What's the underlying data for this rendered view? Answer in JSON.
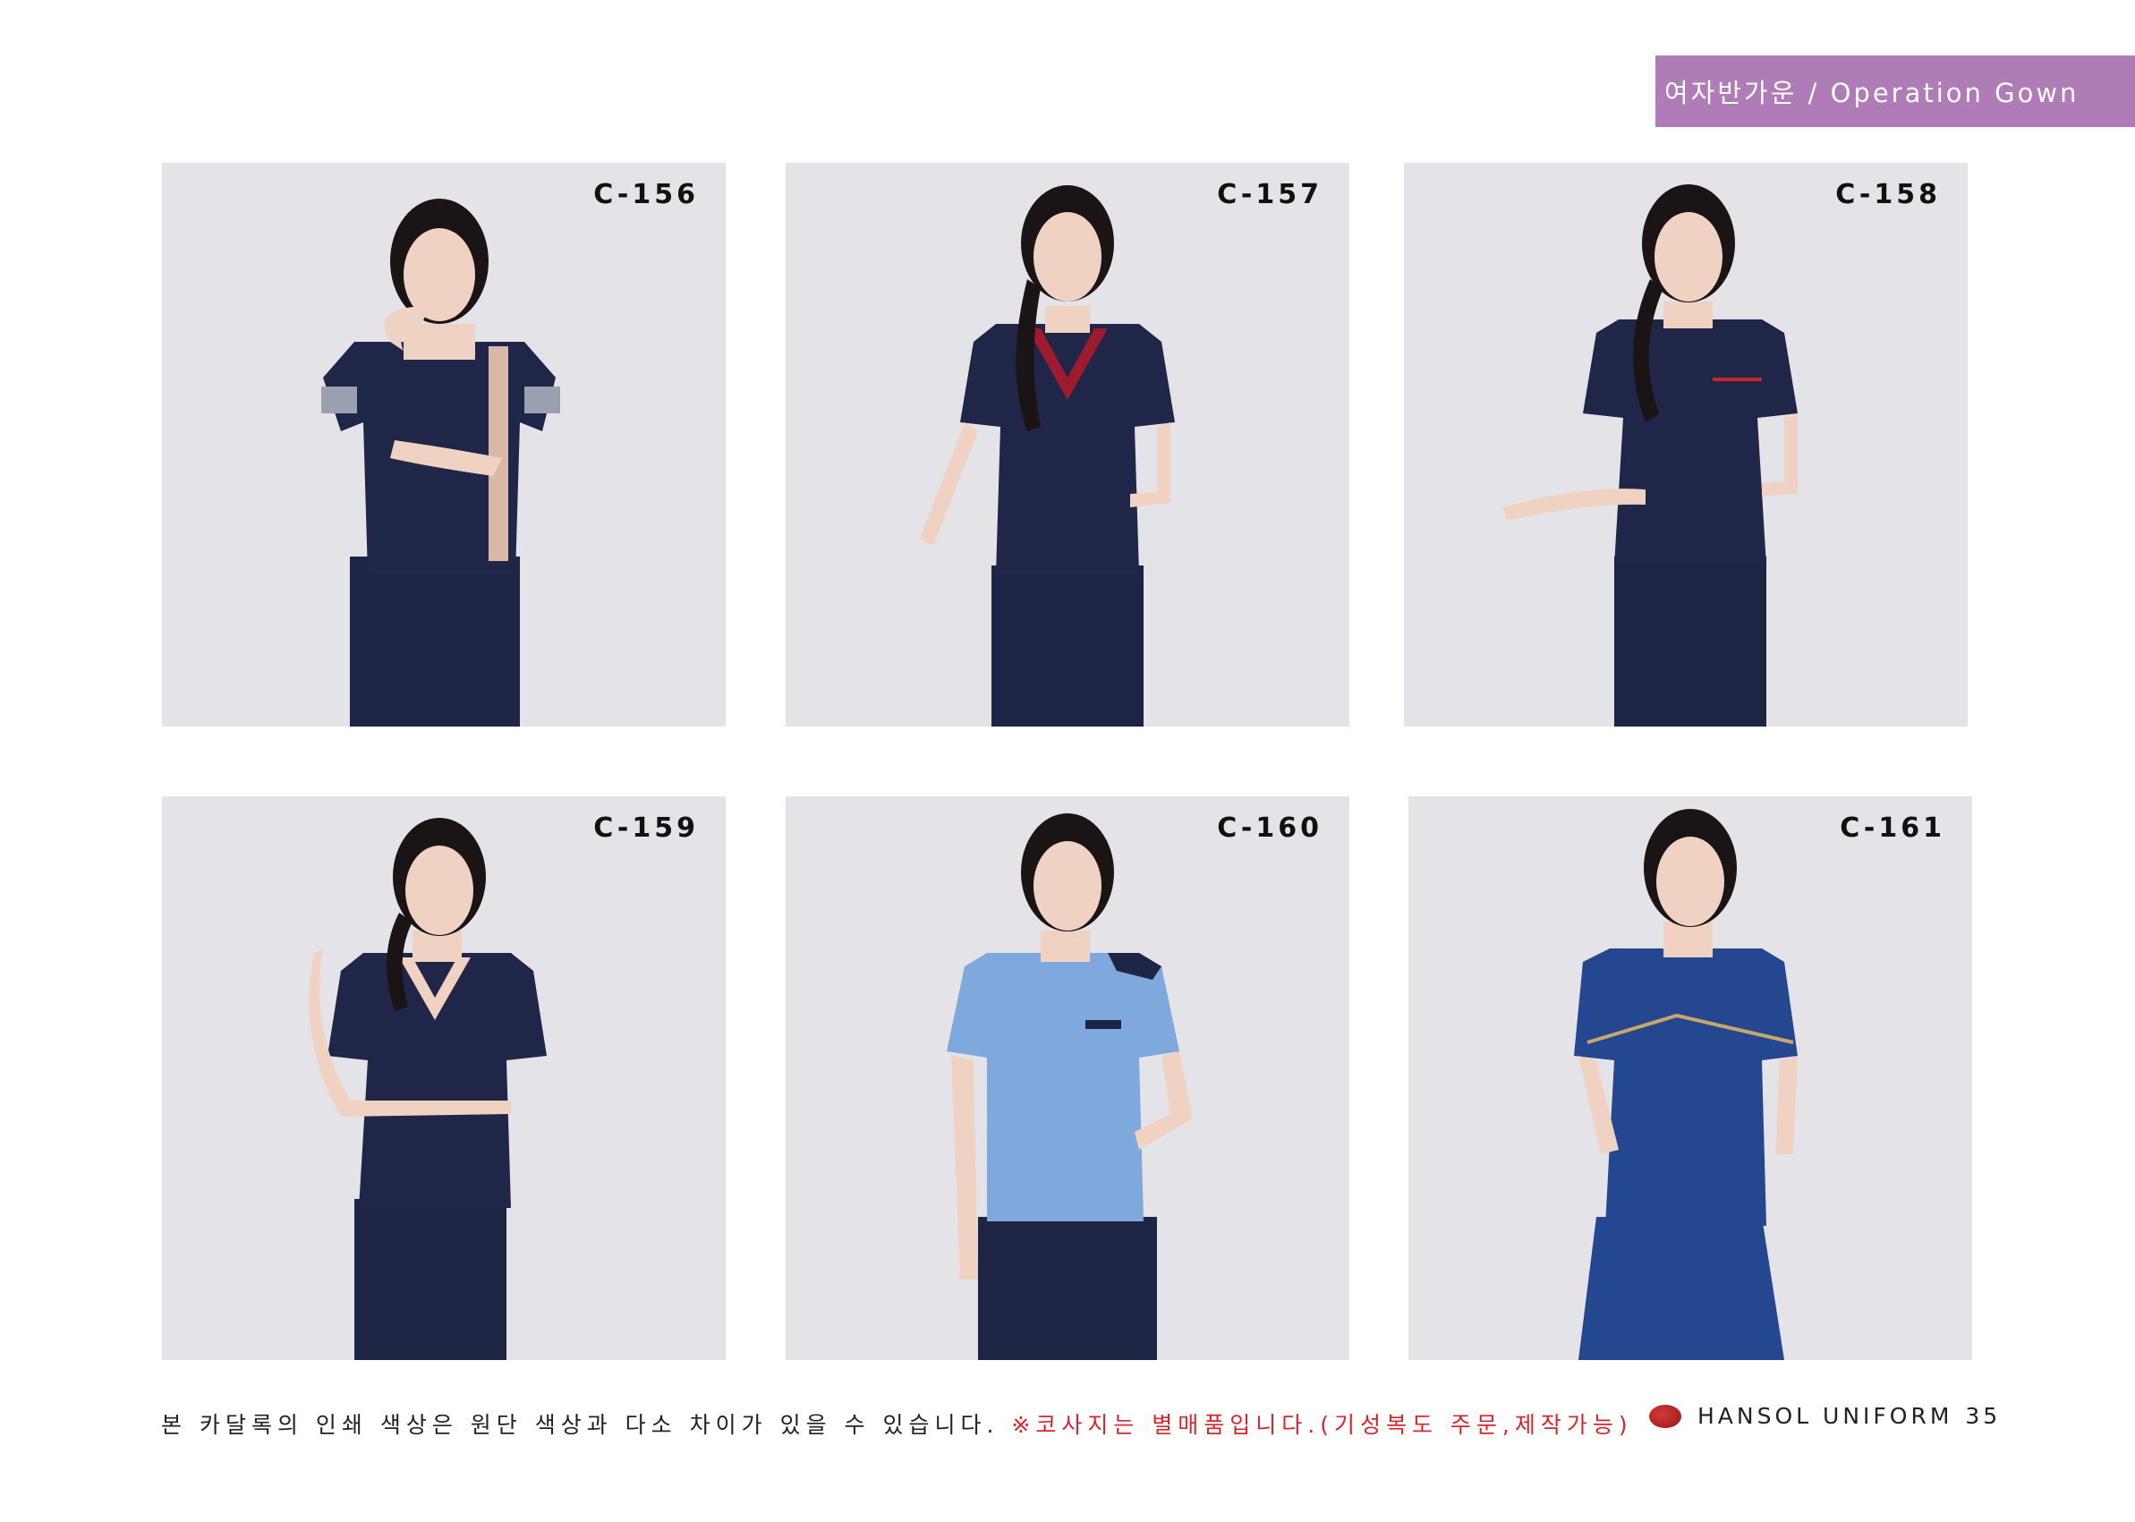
{
  "header": {
    "category_label": "여자반가운 / Operation Gown"
  },
  "products": [
    {
      "code": "C-156",
      "top_color": "#1f2647",
      "trim": "pink-grey strap"
    },
    {
      "code": "C-157",
      "top_color": "#1f2647",
      "trim": "red V-neck"
    },
    {
      "code": "C-158",
      "top_color": "#1f2647",
      "trim": "red pocket line"
    },
    {
      "code": "C-159",
      "top_color": "#1f2647",
      "trim": "plain V-neck"
    },
    {
      "code": "C-160",
      "top_color": "#7fa8dc",
      "trim": "navy shoulder"
    },
    {
      "code": "C-161",
      "top_color": "#24478f",
      "trim": "gold piping"
    }
  ],
  "footer": {
    "note": "본 카달록의 인쇄 색상은 원단 색상과 다소 차이가 있을 수 있습니다.",
    "warning": "※코사지는 별매품입니다.(기성복도 주문,제작가능)",
    "brand": "HANSOL UNIFORM",
    "page_number": "35"
  },
  "colors": {
    "accent": "#b07cb8",
    "warning": "#d8262c",
    "panel_bg": "#e4e3e8",
    "skin": "#efd2c2",
    "hair": "#1a1414"
  }
}
